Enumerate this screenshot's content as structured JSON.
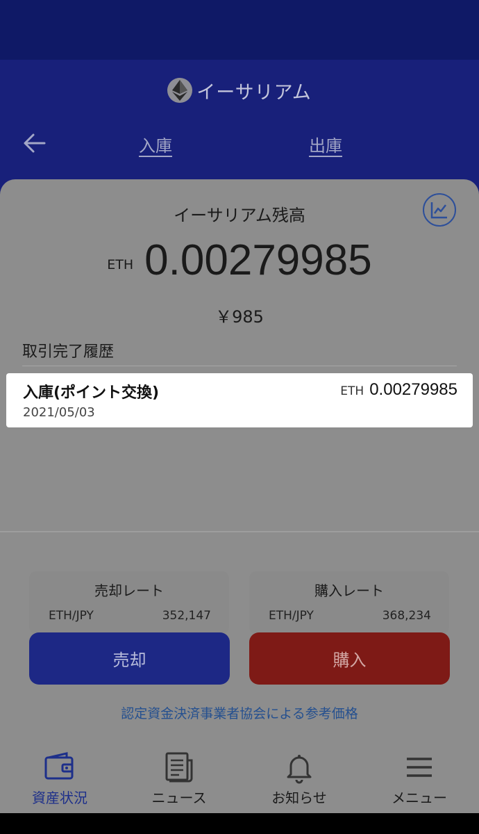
{
  "app": {
    "title": "イーサリアム",
    "nav": {
      "deposit": "入庫",
      "withdraw": "出庫"
    }
  },
  "balance": {
    "label": "イーサリアム残高",
    "unit": "ETH",
    "amount": "0.00279985",
    "fiat": "￥985"
  },
  "history": {
    "title": "取引完了履歴",
    "items": [
      {
        "title": "入庫(ポイント交換)",
        "date": "2021/05/03",
        "unit": "ETH",
        "amount": "0.00279985"
      }
    ]
  },
  "rates": {
    "sell": {
      "title": "売却レート",
      "pair": "ETH/JPY",
      "value": "352,147"
    },
    "buy": {
      "title": "購入レート",
      "pair": "ETH/JPY",
      "value": "368,234"
    }
  },
  "actions": {
    "sell": "売却",
    "buy": "購入"
  },
  "association_link": "認定資金決済事業者協会による参考価格",
  "tabs": [
    {
      "label": "資産状況",
      "icon": "wallet-icon",
      "active": true
    },
    {
      "label": "ニュース",
      "icon": "news-icon",
      "active": false
    },
    {
      "label": "お知らせ",
      "icon": "bell-icon",
      "active": false
    },
    {
      "label": "メニュー",
      "icon": "menu-icon",
      "active": false
    }
  ],
  "colors": {
    "header": "#18207a",
    "sell_button": "#1d2885",
    "buy_button": "#7e1a16",
    "link": "#25508f"
  }
}
